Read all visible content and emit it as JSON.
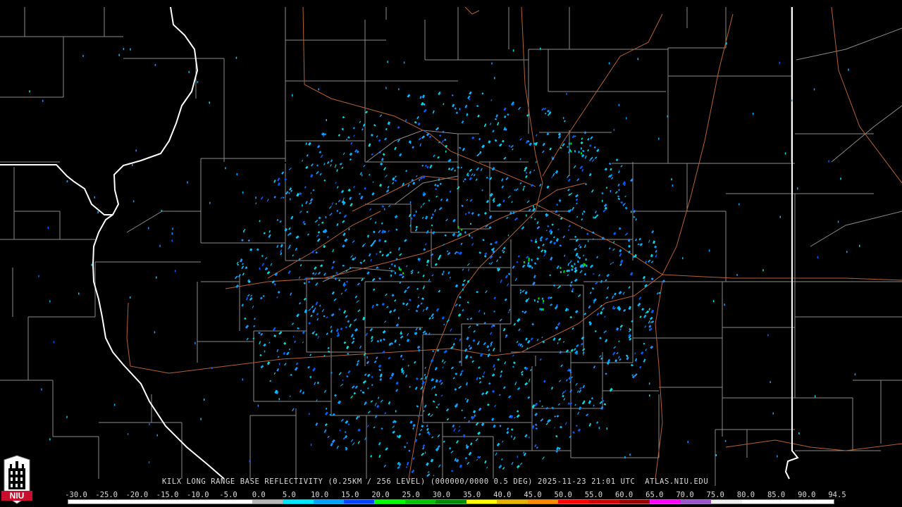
{
  "caption": {
    "radar": "KILX",
    "product": "LONG RANGE BASE REFLECTIVITY",
    "resolution": "(0.25KM / 256 LEVEL)",
    "scan": "(000000/0000 0.5 DEG)",
    "timestamp": "2025-11-23 21:01 UTC",
    "site": "ATLAS.NIU.EDU"
  },
  "logo": {
    "text": "NIU",
    "icon": "niu-tower-logo"
  },
  "colors": {
    "background": "#000000",
    "county_border": "#8a8a8a",
    "state_border": "#ffffff",
    "highway": "#b5602f"
  },
  "scale": {
    "labels": [
      "-30.0",
      "-25.0",
      "-20.0",
      "-15.0",
      "-10.0",
      "-5.0",
      "0.0",
      "5.0",
      "10.0",
      "15.0",
      "20.0",
      "25.0",
      "30.0",
      "35.0",
      "40.0",
      "45.0",
      "50.0",
      "55.0",
      "60.0",
      "65.0",
      "70.0",
      "75.0",
      "80.0",
      "85.0",
      "90.0",
      "94.5"
    ],
    "colors": [
      "#ffffff",
      "#ffffff",
      "#ffffff",
      "#ffffff",
      "#ffffff",
      "#ffffff",
      "#b8b8b8",
      "#00e8ff",
      "#00a0ff",
      "#0044ff",
      "#00ff00",
      "#00c400",
      "#008c00",
      "#ffff00",
      "#e6b400",
      "#ff8c00",
      "#ff0000",
      "#cc0000",
      "#960000",
      "#ff00ff",
      "#9955cc",
      "#eeeeee",
      "#ffffff",
      "#ffffff",
      "#ffffff"
    ]
  }
}
